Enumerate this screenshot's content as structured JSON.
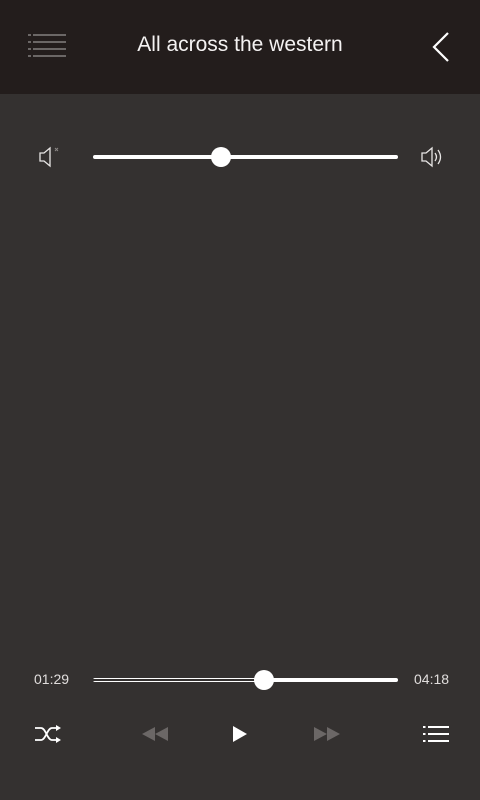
{
  "header": {
    "title": "All across the western",
    "menu_icon": "menu-icon",
    "back_icon": "chevron-left-icon",
    "background": "#231d1c"
  },
  "volume": {
    "level": 0.42,
    "min_icon": "speaker-mute-icon",
    "max_icon": "speaker-loud-icon"
  },
  "playback": {
    "elapsed": "01:29",
    "total": "04:18",
    "progress": 0.56
  },
  "controls": {
    "shuffle_icon": "shuffle-icon",
    "prev_icon": "rewind-icon",
    "play_icon": "play-icon",
    "next_icon": "fast-forward-icon",
    "playlist_icon": "playlist-icon",
    "disabled_color": "#6b6766"
  },
  "colors": {
    "background": "#343130",
    "accent": "#ffffff"
  }
}
